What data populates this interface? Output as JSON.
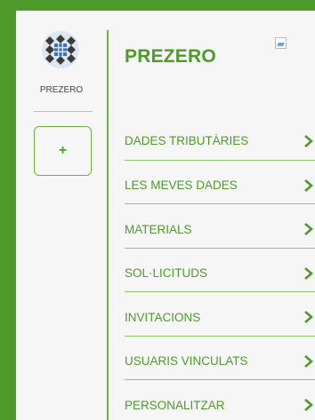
{
  "sidebar": {
    "avatar_label": "PREZERO",
    "add_button_label": "+"
  },
  "header": {
    "title": "PREZERO"
  },
  "menu": {
    "items": [
      {
        "label": "DADES TRIBUTÀRIES"
      },
      {
        "label": "LES MEVES DADES"
      },
      {
        "label": "MATERIALS"
      },
      {
        "label": "SOL·LICITUDS"
      },
      {
        "label": "INVITACIONS"
      },
      {
        "label": "USUARIS VINCULATS"
      },
      {
        "label": "PERSONALITZAR"
      }
    ]
  },
  "colors": {
    "brand_green": "#4e9a2b",
    "divider_green": "#8cc866",
    "panel_background": "#f6f6f6"
  },
  "icons": {
    "chevron": "chevron-right-icon",
    "avatar": "logo-icon",
    "broken_image": "broken-image-icon"
  }
}
